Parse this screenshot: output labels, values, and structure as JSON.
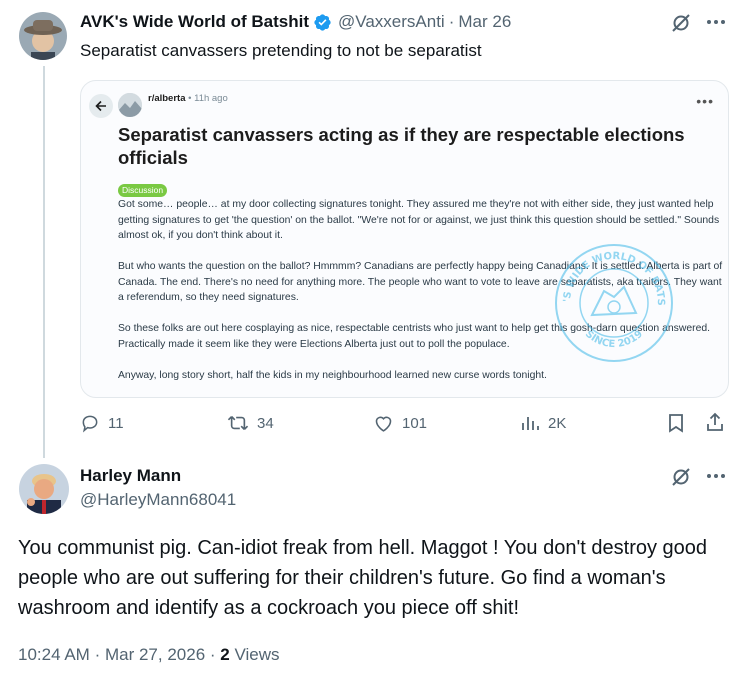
{
  "tweet": {
    "display_name": "AVK's Wide World of Batshit",
    "handle": "@VaxxersAnti",
    "date": "Mar 26",
    "separator": "·",
    "text": "Separatist canvassers pretending to not be separatist",
    "colors": {
      "verified": "#1d9bf0",
      "grok": "#536471"
    }
  },
  "embedded_post": {
    "subreddit": "r/alberta",
    "time": "11h ago",
    "title": "Separatist canvassers acting as if they are respectable elections officials",
    "flair": "Discussion",
    "paragraphs": [
      "Got some… people… at my door collecting signatures tonight. They assured me they're not with either side, they just wanted help getting signatures to get 'the question' on the ballot. \"We're not for or against, we just think this question should be settled.\" Sounds almost ok, if you don't think about it.",
      "But who wants the question on the ballot? Hmmmm? Canadians are perfectly happy being Canadians. It is settled. Alberta is part of Canada. The end. There's no need for anything more. The people who want to vote to leave are separatists, aka traitors. They want a referendum, so they need signatures.",
      "So these folks are out here cosplaying as nice, respectable centrists who just want to help get this gosh-darn question answered. Practically made it seem like they were Elections Alberta just out to poll the populace.",
      "Anyway, long story short, half the kids in my neighbourhood learned new curse words tonight."
    ],
    "watermark": {
      "top_text": "AVK'S WIDE WORLD OF BATSHIT",
      "bottom_text": "SINCE 2019"
    },
    "colors": {
      "flair": "#7ac943",
      "watermark": "#3fb8e8"
    }
  },
  "actions": {
    "replies": "11",
    "reposts": "34",
    "likes": "101",
    "views": "2K"
  },
  "reply": {
    "display_name": "Harley Mann",
    "handle": "@HarleyMann68041",
    "text": "You  communist pig.  Can-idiot freak from hell.  Maggot !  You don't destroy good people who are out suffering for their children's future.  Go find a woman's washroom and identify as a cockroach you piece off shit!",
    "time": "10:24 AM",
    "date": "Mar 27, 2026",
    "separator": "·",
    "views_count": "2",
    "views_label": "Views"
  }
}
